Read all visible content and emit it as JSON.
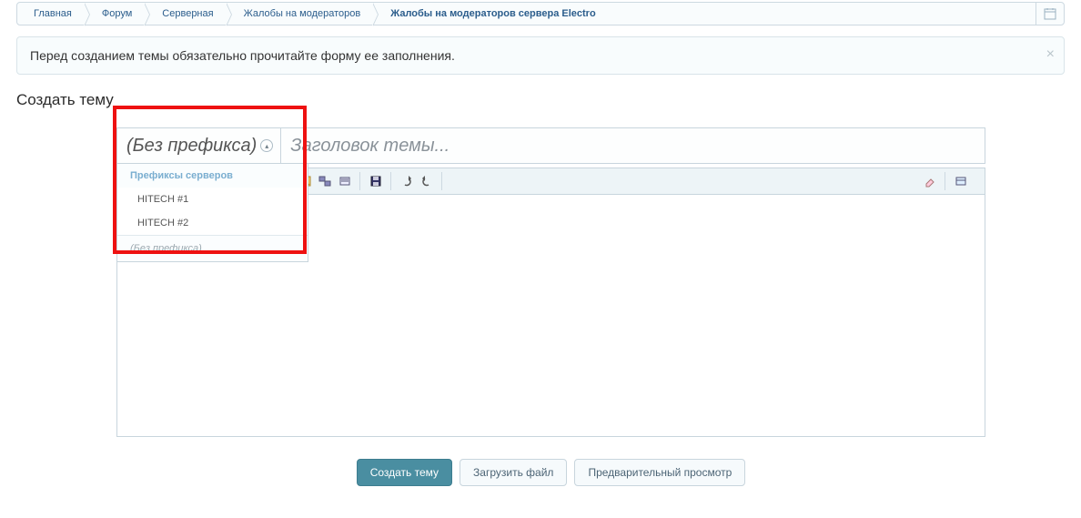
{
  "breadcrumb": {
    "items": [
      "Главная",
      "Форум",
      "Серверная",
      "Жалобы на модераторов"
    ],
    "current": "Жалобы на модераторов сервера Electro"
  },
  "notice": {
    "text": "Перед созданием темы обязательно прочитайте форму ее заполнения."
  },
  "page_title": "Создать тему",
  "prefix": {
    "selected": "(Без префикса)",
    "group_header": "Префиксы серверов",
    "options": [
      "HITECH #1",
      "HITECH #2"
    ],
    "default_label": "(Без префикса)"
  },
  "title_input": {
    "placeholder": "Заголовок темы..."
  },
  "actions": {
    "submit": "Создать тему",
    "upload": "Загрузить файл",
    "preview": "Предварительный просмотр"
  }
}
